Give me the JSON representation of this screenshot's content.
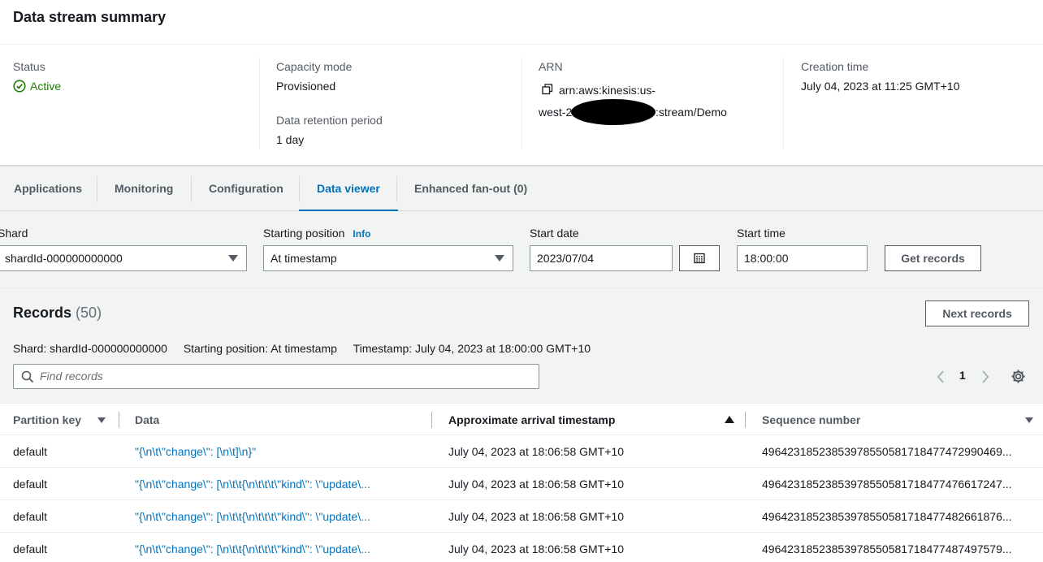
{
  "summary": {
    "title": "Data stream summary",
    "status_label": "Status",
    "status_value": "Active",
    "capacity_label": "Capacity mode",
    "capacity_value": "Provisioned",
    "retention_label": "Data retention period",
    "retention_value": "1 day",
    "arn_label": "ARN",
    "arn_line1": "arn:aws:kinesis:us-",
    "arn_line2_start": "west-2",
    "arn_line2_end": ":stream/Demo",
    "creation_label": "Creation time",
    "creation_value": "July 04, 2023 at 11:25 GMT+10"
  },
  "tabs": [
    {
      "label": "Applications",
      "active": false
    },
    {
      "label": "Monitoring",
      "active": false
    },
    {
      "label": "Configuration",
      "active": false
    },
    {
      "label": "Data viewer",
      "active": true
    },
    {
      "label": "Enhanced fan-out (0)",
      "active": false
    }
  ],
  "filters": {
    "shard_label": "Shard",
    "shard_value": "shardId-000000000000",
    "starting_position_label": "Starting position",
    "info_link": "Info",
    "starting_position_value": "At timestamp",
    "start_date_label": "Start date",
    "start_date_value": "2023/07/04",
    "start_time_label": "Start time",
    "start_time_value": "18:00:00",
    "get_records_label": "Get records"
  },
  "records": {
    "title": "Records",
    "count": "(50)",
    "next_records_label": "Next records",
    "meta_shard": "Shard: shardId-000000000000",
    "meta_position": "Starting position: At timestamp",
    "meta_timestamp": "Timestamp: July 04, 2023 at 18:00:00 GMT+10",
    "search_placeholder": "Find records",
    "page": "1",
    "columns": {
      "partition_key": "Partition key",
      "data": "Data",
      "timestamp": "Approximate arrival timestamp",
      "sequence": "Sequence number"
    },
    "rows": [
      {
        "partition_key": "default",
        "data": "\"{\\n\\t\\\"change\\\": [\\n\\t]\\n}\"",
        "timestamp": "July 04, 2023 at 18:06:58 GMT+10",
        "sequence": "49642318523853978550581718477472990469..."
      },
      {
        "partition_key": "default",
        "data": "\"{\\n\\t\\\"change\\\": [\\n\\t\\t{\\n\\t\\t\\t\\\"kind\\\": \\\"update\\...",
        "timestamp": "July 04, 2023 at 18:06:58 GMT+10",
        "sequence": "49642318523853978550581718477476617247..."
      },
      {
        "partition_key": "default",
        "data": "\"{\\n\\t\\\"change\\\": [\\n\\t\\t{\\n\\t\\t\\t\\\"kind\\\": \\\"update\\...",
        "timestamp": "July 04, 2023 at 18:06:58 GMT+10",
        "sequence": "49642318523853978550581718477482661876..."
      },
      {
        "partition_key": "default",
        "data": "\"{\\n\\t\\\"change\\\": [\\n\\t\\t{\\n\\t\\t\\t\\\"kind\\\": \\\"update\\...",
        "timestamp": "July 04, 2023 at 18:06:58 GMT+10",
        "sequence": "49642318523853978550581718477487497579..."
      }
    ]
  },
  "colors": {
    "link": "#0073bb",
    "success": "#1d8102",
    "panel_bg": "#f2f3f3"
  }
}
